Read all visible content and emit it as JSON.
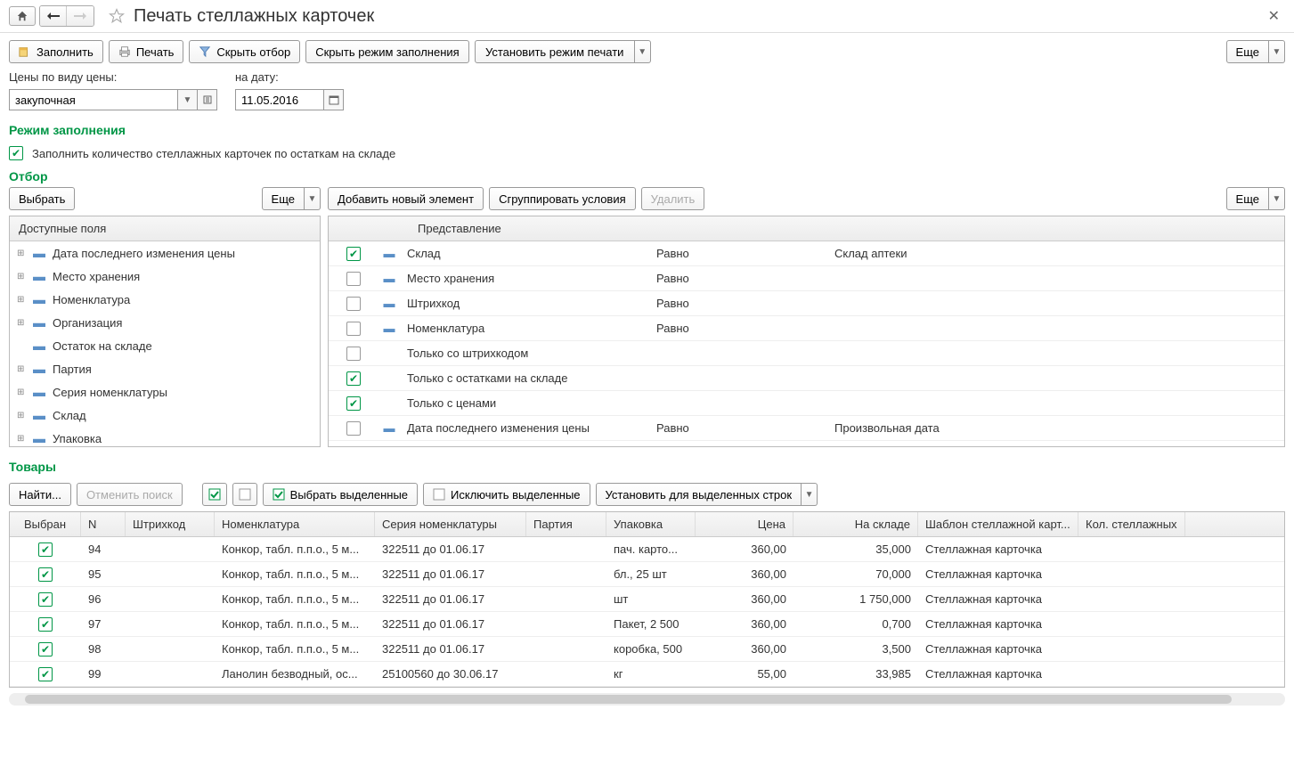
{
  "title": "Печать стеллажных карточек",
  "toolbar": {
    "fill": "Заполнить",
    "print": "Печать",
    "hide_filter": "Скрыть отбор",
    "hide_fill_mode": "Скрыть режим заполнения",
    "set_print_mode": "Установить режим печати",
    "more": "Еще"
  },
  "fields": {
    "price_type_label": "Цены по виду цены:",
    "price_type_value": "закупочная",
    "date_label": "на дату:",
    "date_value": "11.05.2016"
  },
  "fill_mode": {
    "title": "Режим заполнения",
    "check_label": "Заполнить количество стеллажных карточек по остаткам на складе"
  },
  "filter": {
    "title": "Отбор",
    "select": "Выбрать",
    "more": "Еще",
    "add": "Добавить новый элемент",
    "group": "Сгруппировать условия",
    "delete": "Удалить",
    "available_fields": "Доступные поля",
    "presentation": "Представление",
    "tree": [
      {
        "exp": true,
        "label": "Дата последнего изменения цены"
      },
      {
        "exp": true,
        "label": "Место хранения"
      },
      {
        "exp": true,
        "label": "Номенклатура"
      },
      {
        "exp": true,
        "label": "Организация"
      },
      {
        "exp": false,
        "label": "Остаток на складе"
      },
      {
        "exp": true,
        "label": "Партия"
      },
      {
        "exp": true,
        "label": "Серия номенклатуры"
      },
      {
        "exp": true,
        "label": "Склад"
      },
      {
        "exp": true,
        "label": "Упаковка"
      }
    ],
    "rows": [
      {
        "checked": true,
        "dash": true,
        "name": "Склад",
        "op": "Равно",
        "val": "Склад аптеки"
      },
      {
        "checked": false,
        "dash": true,
        "name": "Место хранения",
        "op": "Равно",
        "val": ""
      },
      {
        "checked": false,
        "dash": true,
        "name": "Штрихкод",
        "op": "Равно",
        "val": ""
      },
      {
        "checked": false,
        "dash": true,
        "name": "Номенклатура",
        "op": "Равно",
        "val": ""
      },
      {
        "checked": false,
        "dash": false,
        "name": "Только со штрихкодом",
        "op": "",
        "val": ""
      },
      {
        "checked": true,
        "dash": false,
        "name": "Только с остатками на складе",
        "op": "",
        "val": ""
      },
      {
        "checked": true,
        "dash": false,
        "name": "Только с ценами",
        "op": "",
        "val": ""
      },
      {
        "checked": false,
        "dash": true,
        "name": "Дата последнего изменения цены",
        "op": "Равно",
        "val": "Произвольная дата"
      }
    ]
  },
  "goods": {
    "title": "Товары",
    "find": "Найти...",
    "cancel_find": "Отменить поиск",
    "select_marked": "Выбрать выделенные",
    "exclude_marked": "Исключить выделенные",
    "set_for_marked": "Установить для выделенных строк",
    "cols": {
      "sel": "Выбран",
      "n": "N",
      "bc": "Штрихкод",
      "nom": "Номенклатура",
      "ser": "Серия номенклатуры",
      "par": "Партия",
      "pack": "Упаковка",
      "price": "Цена",
      "stock": "На складе",
      "tpl": "Шаблон стеллажной карт...",
      "cnt": "Кол. стеллажных"
    },
    "rows": [
      {
        "n": "94",
        "nom": "Конкор, табл. п.п.о., 5 м...",
        "ser": "322511 до 01.06.17",
        "pack": "пач. карто...",
        "price": "360,00",
        "stock": "35,000",
        "tpl": "Стеллажная карточка"
      },
      {
        "n": "95",
        "nom": "Конкор, табл. п.п.о., 5 м...",
        "ser": "322511 до 01.06.17",
        "pack": "бл., 25 шт",
        "price": "360,00",
        "stock": "70,000",
        "tpl": "Стеллажная карточка"
      },
      {
        "n": "96",
        "nom": "Конкор, табл. п.п.о., 5 м...",
        "ser": "322511 до 01.06.17",
        "pack": "шт",
        "price": "360,00",
        "stock": "1 750,000",
        "tpl": "Стеллажная карточка"
      },
      {
        "n": "97",
        "nom": "Конкор, табл. п.п.о., 5 м...",
        "ser": "322511 до 01.06.17",
        "pack": "Пакет, 2 500",
        "price": "360,00",
        "stock": "0,700",
        "tpl": "Стеллажная карточка"
      },
      {
        "n": "98",
        "nom": "Конкор, табл. п.п.о., 5 м...",
        "ser": "322511 до 01.06.17",
        "pack": "коробка, 500",
        "price": "360,00",
        "stock": "3,500",
        "tpl": "Стеллажная карточка"
      },
      {
        "n": "99",
        "nom": "Ланолин безводный, ос...",
        "ser": "25100560 до 30.06.17",
        "pack": "кг",
        "price": "55,00",
        "stock": "33,985",
        "tpl": "Стеллажная карточка"
      }
    ]
  }
}
